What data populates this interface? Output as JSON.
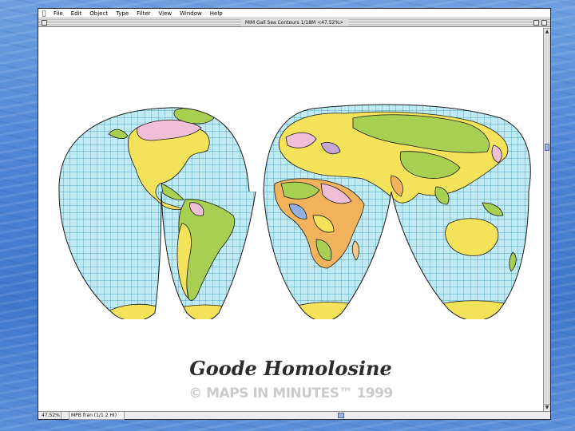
{
  "menubar": {
    "apple_icon": "apple-icon",
    "items": [
      "File",
      "Edit",
      "Object",
      "Type",
      "Filter",
      "View",
      "Window",
      "Help"
    ]
  },
  "window": {
    "title": "MIM Gall Sea Contours 1/18M <47.52%>"
  },
  "map": {
    "projection_title": "Goode Homolosine",
    "copyright": "© MAPS IN MINUTES™ 1999",
    "colors": {
      "ocean": "#bfeaf3",
      "graticule": "#2e8fb0",
      "outline": "#1a1a1a",
      "land_yellow": "#f4e35a",
      "land_green": "#a7cf52",
      "land_pink": "#eebfd6",
      "land_lilac": "#c6a6d6",
      "land_orange": "#f2b35c",
      "land_blue": "#8fb0e0",
      "land_peach": "#f3c98a"
    }
  },
  "statusbar": {
    "zoom": "47.52%",
    "info": "MPB fran (1/1 2 HI)"
  },
  "background": {
    "slide_color": "#4f86d6"
  }
}
